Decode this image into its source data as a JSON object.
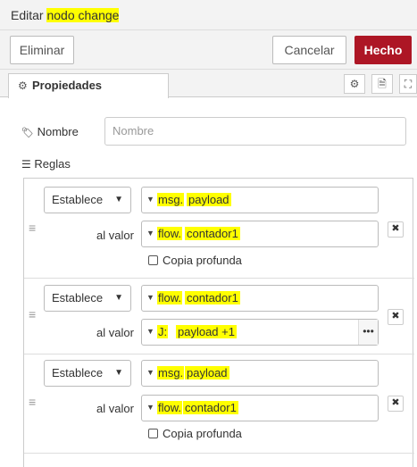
{
  "header": {
    "title_prefix": "Editar ",
    "title_node": "nodo change"
  },
  "toolbar": {
    "delete_label": "Eliminar",
    "cancel_label": "Cancelar",
    "done_label": "Hecho"
  },
  "tabs": {
    "properties_label": "Propiedades"
  },
  "form": {
    "name_label": "Nombre",
    "name_placeholder": "Nombre",
    "rules_label": "Reglas",
    "value_label": "al valor",
    "deep_copy_label": "Copia profunda"
  },
  "rules": [
    {
      "action": "Establece",
      "target_type": "msg.",
      "target_value": "payload",
      "value_type": "flow.",
      "value_value": "contador1",
      "deep_copy": false
    },
    {
      "action": "Establece",
      "target_type": "flow.",
      "target_value": "contador1",
      "value_type": "J:",
      "value_value": "payload +1",
      "value_more": "•••"
    },
    {
      "action": "Establece",
      "target_type": "msg.",
      "target_value": "payload",
      "value_type": "flow.",
      "value_value": "contador1",
      "deep_copy": false
    }
  ],
  "icons": {
    "gear": "gear-icon",
    "tag": "tag-icon",
    "list": "list-icon",
    "delete": "close-icon",
    "handle": "drag-handle-icon"
  },
  "colors": {
    "done_button": "#ad1625",
    "highlight": "#ffff00"
  }
}
